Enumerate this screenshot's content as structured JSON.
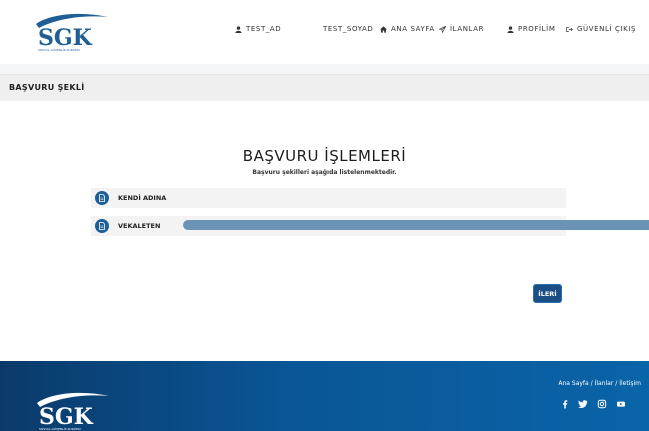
{
  "header": {
    "logo_text": "SGK",
    "logo_subtext": "SOSYAL GÜVENLİK KURUMU",
    "nav": {
      "first_name": "TEST_AD",
      "last_name": "TEST_SOYAD",
      "home": "ANA SAYFA",
      "listings": "İLANLAR",
      "profile": "PROFİLİM",
      "logout": "GÜVENLİ ÇIKIŞ"
    }
  },
  "page": {
    "section_title": "BAŞVURU ŞEKLİ"
  },
  "main": {
    "title": "BAŞVURU İŞLEMLERİ",
    "subtitle": "Başvuru şekilleri aşağıda listelenmektedir.",
    "options": [
      {
        "label": "KENDİ ADINA"
      },
      {
        "label": "VEKALETEN"
      }
    ],
    "next_button": "İLERİ"
  },
  "footer": {
    "links": {
      "home": "Ana Sayfa",
      "sep1": "/",
      "listings": "İlanlar",
      "sep2": "/",
      "contact": "İletişim"
    },
    "social_icons": [
      "facebook-icon",
      "twitter-icon",
      "instagram-icon",
      "youtube-icon"
    ]
  },
  "colors": {
    "primary": "#1f5f96",
    "selection": "#6b93b6",
    "button": "#1a4f86",
    "footer": "#0a5697"
  }
}
